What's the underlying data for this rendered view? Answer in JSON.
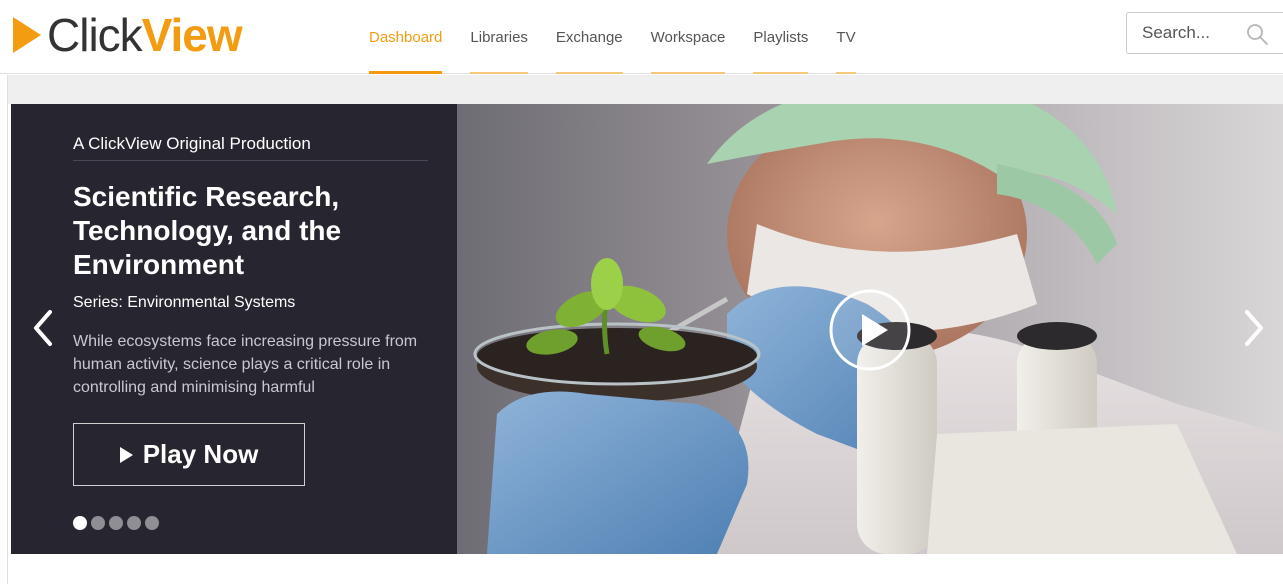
{
  "brand": {
    "click": "Click",
    "view": "View",
    "accent": "#f39c12"
  },
  "nav": {
    "items": [
      {
        "label": "Dashboard",
        "active": true
      },
      {
        "label": "Libraries",
        "active": false
      },
      {
        "label": "Exchange",
        "active": false
      },
      {
        "label": "Workspace",
        "active": false
      },
      {
        "label": "Playlists",
        "active": false
      },
      {
        "label": "TV",
        "active": false
      }
    ]
  },
  "search": {
    "placeholder": "Search...",
    "icon": "search-icon"
  },
  "hero": {
    "eyebrow": "A ClickView Original Production",
    "title": "Scientific Research, Technology, and the Environment",
    "series": "Series: Environmental Systems",
    "description": "While ecosystems face increasing pressure from human activity, science plays a critical role in controlling and minimising harmful",
    "play_label": "Play Now",
    "slide_count": 5,
    "active_slide": 1,
    "panel_color": "#27252f",
    "icons": [
      "chevron-left-icon",
      "chevron-right-icon",
      "play-circle-icon"
    ]
  }
}
